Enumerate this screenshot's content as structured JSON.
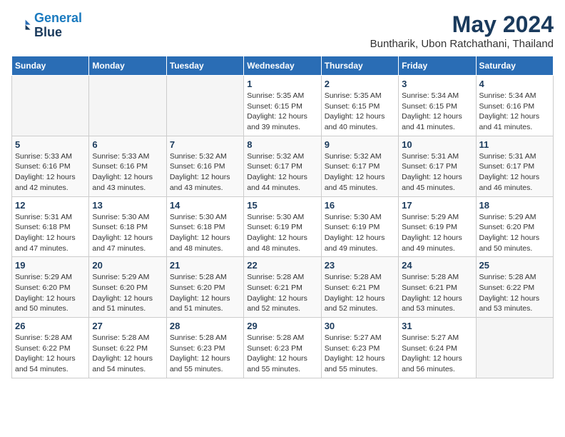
{
  "logo": {
    "line1": "General",
    "line2": "Blue"
  },
  "title": "May 2024",
  "location": "Buntharik, Ubon Ratchathani, Thailand",
  "days_header": [
    "Sunday",
    "Monday",
    "Tuesday",
    "Wednesday",
    "Thursday",
    "Friday",
    "Saturday"
  ],
  "weeks": [
    [
      {
        "day": "",
        "info": ""
      },
      {
        "day": "",
        "info": ""
      },
      {
        "day": "",
        "info": ""
      },
      {
        "day": "1",
        "info": "Sunrise: 5:35 AM\nSunset: 6:15 PM\nDaylight: 12 hours\nand 39 minutes."
      },
      {
        "day": "2",
        "info": "Sunrise: 5:35 AM\nSunset: 6:15 PM\nDaylight: 12 hours\nand 40 minutes."
      },
      {
        "day": "3",
        "info": "Sunrise: 5:34 AM\nSunset: 6:15 PM\nDaylight: 12 hours\nand 41 minutes."
      },
      {
        "day": "4",
        "info": "Sunrise: 5:34 AM\nSunset: 6:16 PM\nDaylight: 12 hours\nand 41 minutes."
      }
    ],
    [
      {
        "day": "5",
        "info": "Sunrise: 5:33 AM\nSunset: 6:16 PM\nDaylight: 12 hours\nand 42 minutes."
      },
      {
        "day": "6",
        "info": "Sunrise: 5:33 AM\nSunset: 6:16 PM\nDaylight: 12 hours\nand 43 minutes."
      },
      {
        "day": "7",
        "info": "Sunrise: 5:32 AM\nSunset: 6:16 PM\nDaylight: 12 hours\nand 43 minutes."
      },
      {
        "day": "8",
        "info": "Sunrise: 5:32 AM\nSunset: 6:17 PM\nDaylight: 12 hours\nand 44 minutes."
      },
      {
        "day": "9",
        "info": "Sunrise: 5:32 AM\nSunset: 6:17 PM\nDaylight: 12 hours\nand 45 minutes."
      },
      {
        "day": "10",
        "info": "Sunrise: 5:31 AM\nSunset: 6:17 PM\nDaylight: 12 hours\nand 45 minutes."
      },
      {
        "day": "11",
        "info": "Sunrise: 5:31 AM\nSunset: 6:17 PM\nDaylight: 12 hours\nand 46 minutes."
      }
    ],
    [
      {
        "day": "12",
        "info": "Sunrise: 5:31 AM\nSunset: 6:18 PM\nDaylight: 12 hours\nand 47 minutes."
      },
      {
        "day": "13",
        "info": "Sunrise: 5:30 AM\nSunset: 6:18 PM\nDaylight: 12 hours\nand 47 minutes."
      },
      {
        "day": "14",
        "info": "Sunrise: 5:30 AM\nSunset: 6:18 PM\nDaylight: 12 hours\nand 48 minutes."
      },
      {
        "day": "15",
        "info": "Sunrise: 5:30 AM\nSunset: 6:19 PM\nDaylight: 12 hours\nand 48 minutes."
      },
      {
        "day": "16",
        "info": "Sunrise: 5:30 AM\nSunset: 6:19 PM\nDaylight: 12 hours\nand 49 minutes."
      },
      {
        "day": "17",
        "info": "Sunrise: 5:29 AM\nSunset: 6:19 PM\nDaylight: 12 hours\nand 49 minutes."
      },
      {
        "day": "18",
        "info": "Sunrise: 5:29 AM\nSunset: 6:20 PM\nDaylight: 12 hours\nand 50 minutes."
      }
    ],
    [
      {
        "day": "19",
        "info": "Sunrise: 5:29 AM\nSunset: 6:20 PM\nDaylight: 12 hours\nand 50 minutes."
      },
      {
        "day": "20",
        "info": "Sunrise: 5:29 AM\nSunset: 6:20 PM\nDaylight: 12 hours\nand 51 minutes."
      },
      {
        "day": "21",
        "info": "Sunrise: 5:28 AM\nSunset: 6:20 PM\nDaylight: 12 hours\nand 51 minutes."
      },
      {
        "day": "22",
        "info": "Sunrise: 5:28 AM\nSunset: 6:21 PM\nDaylight: 12 hours\nand 52 minutes."
      },
      {
        "day": "23",
        "info": "Sunrise: 5:28 AM\nSunset: 6:21 PM\nDaylight: 12 hours\nand 52 minutes."
      },
      {
        "day": "24",
        "info": "Sunrise: 5:28 AM\nSunset: 6:21 PM\nDaylight: 12 hours\nand 53 minutes."
      },
      {
        "day": "25",
        "info": "Sunrise: 5:28 AM\nSunset: 6:22 PM\nDaylight: 12 hours\nand 53 minutes."
      }
    ],
    [
      {
        "day": "26",
        "info": "Sunrise: 5:28 AM\nSunset: 6:22 PM\nDaylight: 12 hours\nand 54 minutes."
      },
      {
        "day": "27",
        "info": "Sunrise: 5:28 AM\nSunset: 6:22 PM\nDaylight: 12 hours\nand 54 minutes."
      },
      {
        "day": "28",
        "info": "Sunrise: 5:28 AM\nSunset: 6:23 PM\nDaylight: 12 hours\nand 55 minutes."
      },
      {
        "day": "29",
        "info": "Sunrise: 5:28 AM\nSunset: 6:23 PM\nDaylight: 12 hours\nand 55 minutes."
      },
      {
        "day": "30",
        "info": "Sunrise: 5:27 AM\nSunset: 6:23 PM\nDaylight: 12 hours\nand 55 minutes."
      },
      {
        "day": "31",
        "info": "Sunrise: 5:27 AM\nSunset: 6:24 PM\nDaylight: 12 hours\nand 56 minutes."
      },
      {
        "day": "",
        "info": ""
      }
    ]
  ]
}
